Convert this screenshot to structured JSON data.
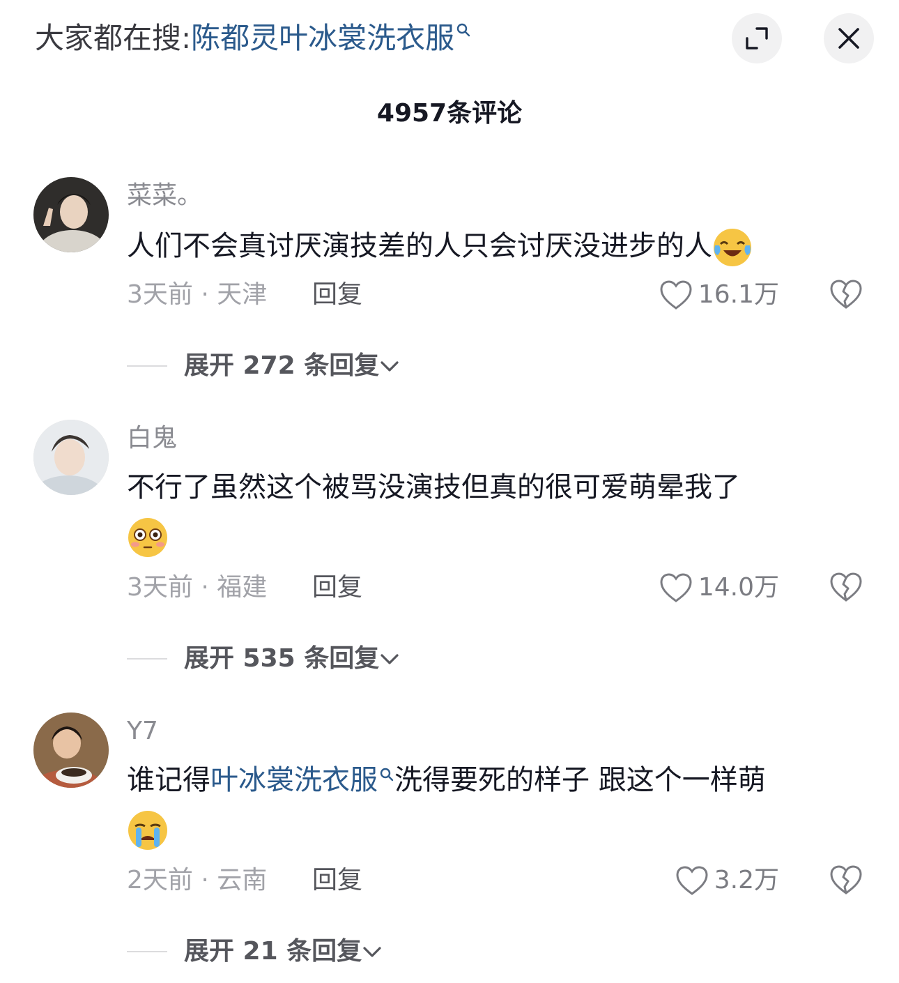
{
  "header": {
    "search_prefix": "大家都在搜:",
    "search_term": "陈都灵叶冰裳洗衣服"
  },
  "comment_count_title": "4957条评论",
  "comments": [
    {
      "username": "菜菜。",
      "text": "人们不会真讨厌演技差的人只会讨厌没进步的人",
      "emoji": "laughing-crying-emoji",
      "meta": "3天前 · 天津",
      "reply_label": "回复",
      "likes": "16.1万",
      "expand_label": "展开 272 条回复"
    },
    {
      "username": "白鬼",
      "text": "不行了虽然这个被骂没演技但真的很可爱萌晕我了",
      "emoji": "flushed-emoji",
      "meta": "3天前 · 福建",
      "reply_label": "回复",
      "likes": "14.0万",
      "expand_label": "展开 535 条回复"
    },
    {
      "username": "Y7",
      "text_before": "谁记得",
      "text_link": "叶冰裳洗衣服",
      "text_after": "洗得要死的样子 跟这个一样萌",
      "emoji": "crying-emoji",
      "meta": "2天前 · 云南",
      "reply_label": "回复",
      "likes": "3.2万",
      "expand_label": "展开 21 条回复"
    }
  ],
  "colors": {
    "link": "#2b5a8c",
    "text": "#161823",
    "muted": "#a1a2a8"
  }
}
